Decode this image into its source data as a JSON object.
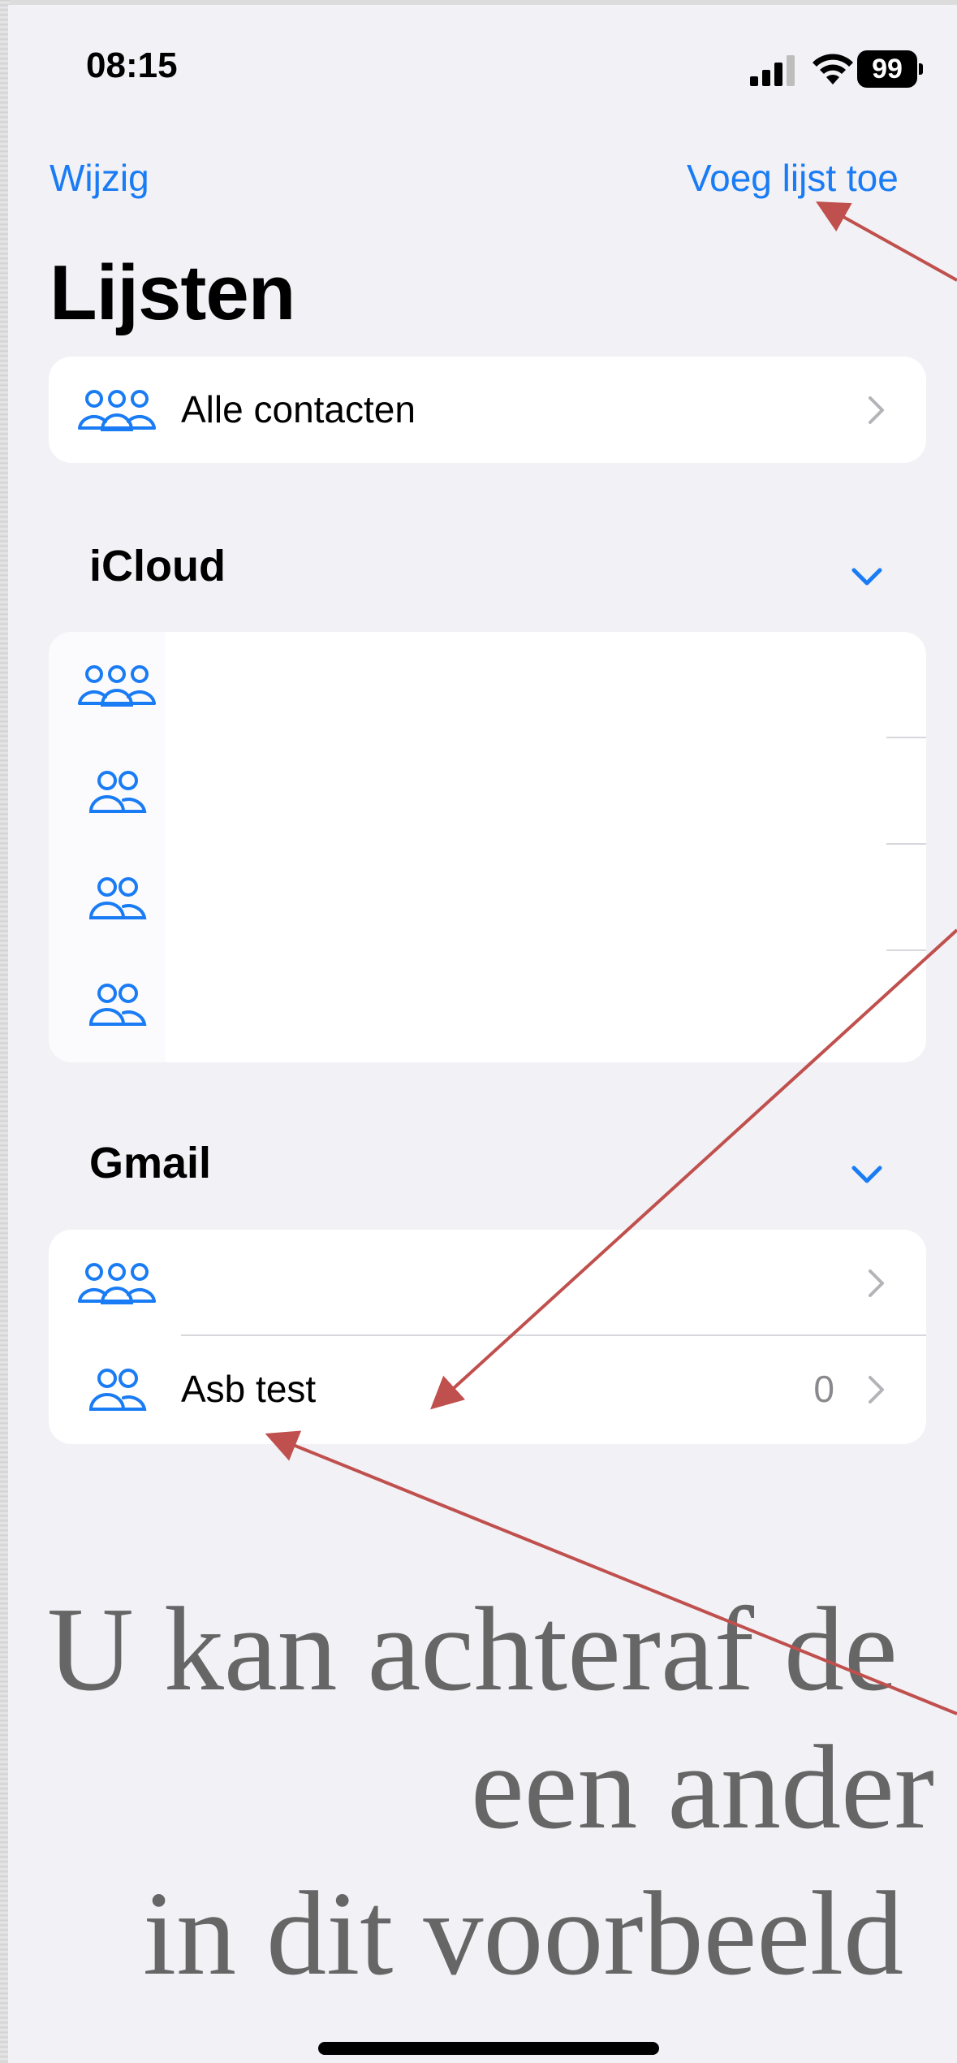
{
  "status_bar": {
    "time": "08:15",
    "battery": "99"
  },
  "nav": {
    "edit_label": "Wijzig",
    "add_label": "Voeg lijst toe"
  },
  "page_title": "Lijsten",
  "all_contacts": {
    "label": "Alle contacten",
    "icon": "group-icon"
  },
  "sections": [
    {
      "header": "iCloud",
      "rows": [
        {
          "label": "",
          "icon": "group-icon"
        },
        {
          "label": "",
          "icon": "pair-icon"
        },
        {
          "label": "",
          "icon": "pair-icon"
        },
        {
          "label": "",
          "icon": "pair-icon"
        }
      ]
    },
    {
      "header": "Gmail",
      "rows": [
        {
          "label": "",
          "icon": "group-icon"
        },
        {
          "label": "Asb test",
          "count": "0",
          "icon": "pair-icon"
        }
      ]
    }
  ],
  "caption": {
    "line1": "U kan achteraf de",
    "line2": "een ander",
    "line3": "in dit voorbeeld"
  },
  "colors": {
    "accent": "#1a7cf4",
    "arrow": "#c0504d",
    "background": "#f1f1f6"
  }
}
